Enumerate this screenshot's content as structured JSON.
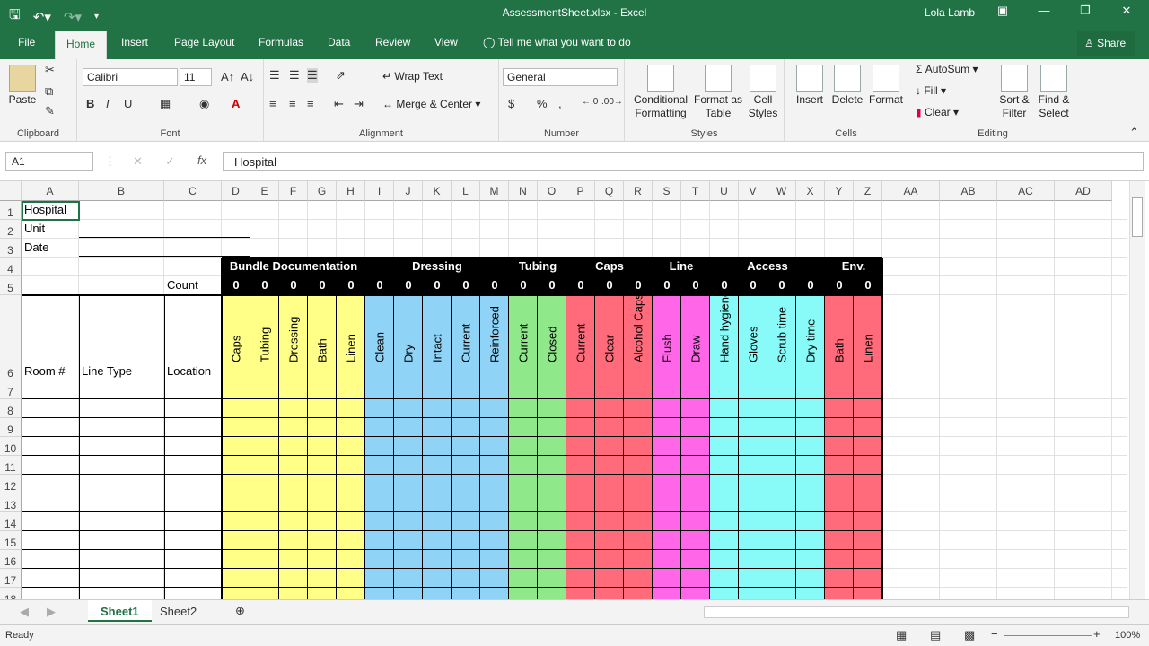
{
  "titlebar": {
    "doc_title": "AssessmentSheet.xlsx - Excel",
    "user": "Lola Lamb"
  },
  "menu": {
    "tabs": [
      "File",
      "Home",
      "Insert",
      "Page Layout",
      "Formulas",
      "Data",
      "Review",
      "View"
    ],
    "tell_me": "Tell me what you want to do",
    "share": "Share"
  },
  "ribbon": {
    "paste": "Paste",
    "clipboard": "Clipboard",
    "font_name": "Calibri",
    "font_size": "11",
    "font_group": "Font",
    "wrap_text": "Wrap Text",
    "merge_center": "Merge & Center",
    "alignment": "Alignment",
    "number_format": "General",
    "number": "Number",
    "conditional_formatting": "Conditional Formatting",
    "format_as_table": "Format as Table",
    "cell_styles": "Cell Styles",
    "styles": "Styles",
    "insert": "Insert",
    "delete": "Delete",
    "format": "Format",
    "cells": "Cells",
    "autosum": "AutoSum",
    "fill": "Fill",
    "clear": "Clear",
    "sort_filter": "Sort & Filter",
    "find_select": "Find & Select",
    "editing": "Editing"
  },
  "formula": {
    "name_box": "A1",
    "content": "Hospital"
  },
  "columns": [
    "A",
    "B",
    "C",
    "D",
    "E",
    "F",
    "G",
    "H",
    "I",
    "J",
    "K",
    "L",
    "M",
    "N",
    "O",
    "P",
    "Q",
    "R",
    "S",
    "T",
    "U",
    "V",
    "W",
    "X",
    "Y",
    "Z",
    "AA",
    "AB",
    "AC",
    "AD"
  ],
  "rows": [
    "1",
    "2",
    "3",
    "4",
    "5",
    "6",
    "7",
    "8",
    "9",
    "10",
    "11",
    "12",
    "13",
    "14",
    "15",
    "16",
    "17",
    "18"
  ],
  "cells": {
    "a1": "Hospital",
    "a2": "Unit",
    "a3": "Date",
    "c5": "Count",
    "a6": "Room #",
    "b6": "Line Type",
    "c6": "Location"
  },
  "sections": [
    {
      "title": "Bundle Documentation",
      "color": "#ffff88",
      "items": [
        "Caps",
        "Tubing",
        "Dressing",
        "Bath",
        "Linen"
      ]
    },
    {
      "title": "Dressing",
      "color": "#8fd3f7",
      "items": [
        "Clean",
        "Dry",
        "Intact",
        "Current",
        "Reinforced"
      ]
    },
    {
      "title": "Tubing",
      "color": "#8fe88a",
      "items": [
        "Current",
        "Closed"
      ]
    },
    {
      "title": "Caps",
      "color": "#ff6b7a",
      "items": [
        "Current",
        "Clear",
        "Alcohol Caps"
      ]
    },
    {
      "title": "Line",
      "color": "#ff66e8",
      "items": [
        "Flush",
        "Draw"
      ]
    },
    {
      "title": "Access",
      "color": "#88fbf8",
      "items": [
        "Hand hygiene",
        "Gloves",
        "Scrub time",
        "Dry time"
      ]
    },
    {
      "title": "Env.",
      "color": "#ff6b7a",
      "items": [
        "Bath",
        "Linen"
      ]
    }
  ],
  "counts": [
    "0",
    "0",
    "0",
    "0",
    "0",
    "0",
    "0",
    "0",
    "0",
    "0",
    "0",
    "0",
    "0",
    "0",
    "0",
    "0",
    "0",
    "0",
    "0",
    "0",
    "0",
    "0",
    "0"
  ],
  "sheets": [
    "Sheet1",
    "Sheet2"
  ],
  "status": {
    "ready": "Ready",
    "zoom": "100%"
  }
}
